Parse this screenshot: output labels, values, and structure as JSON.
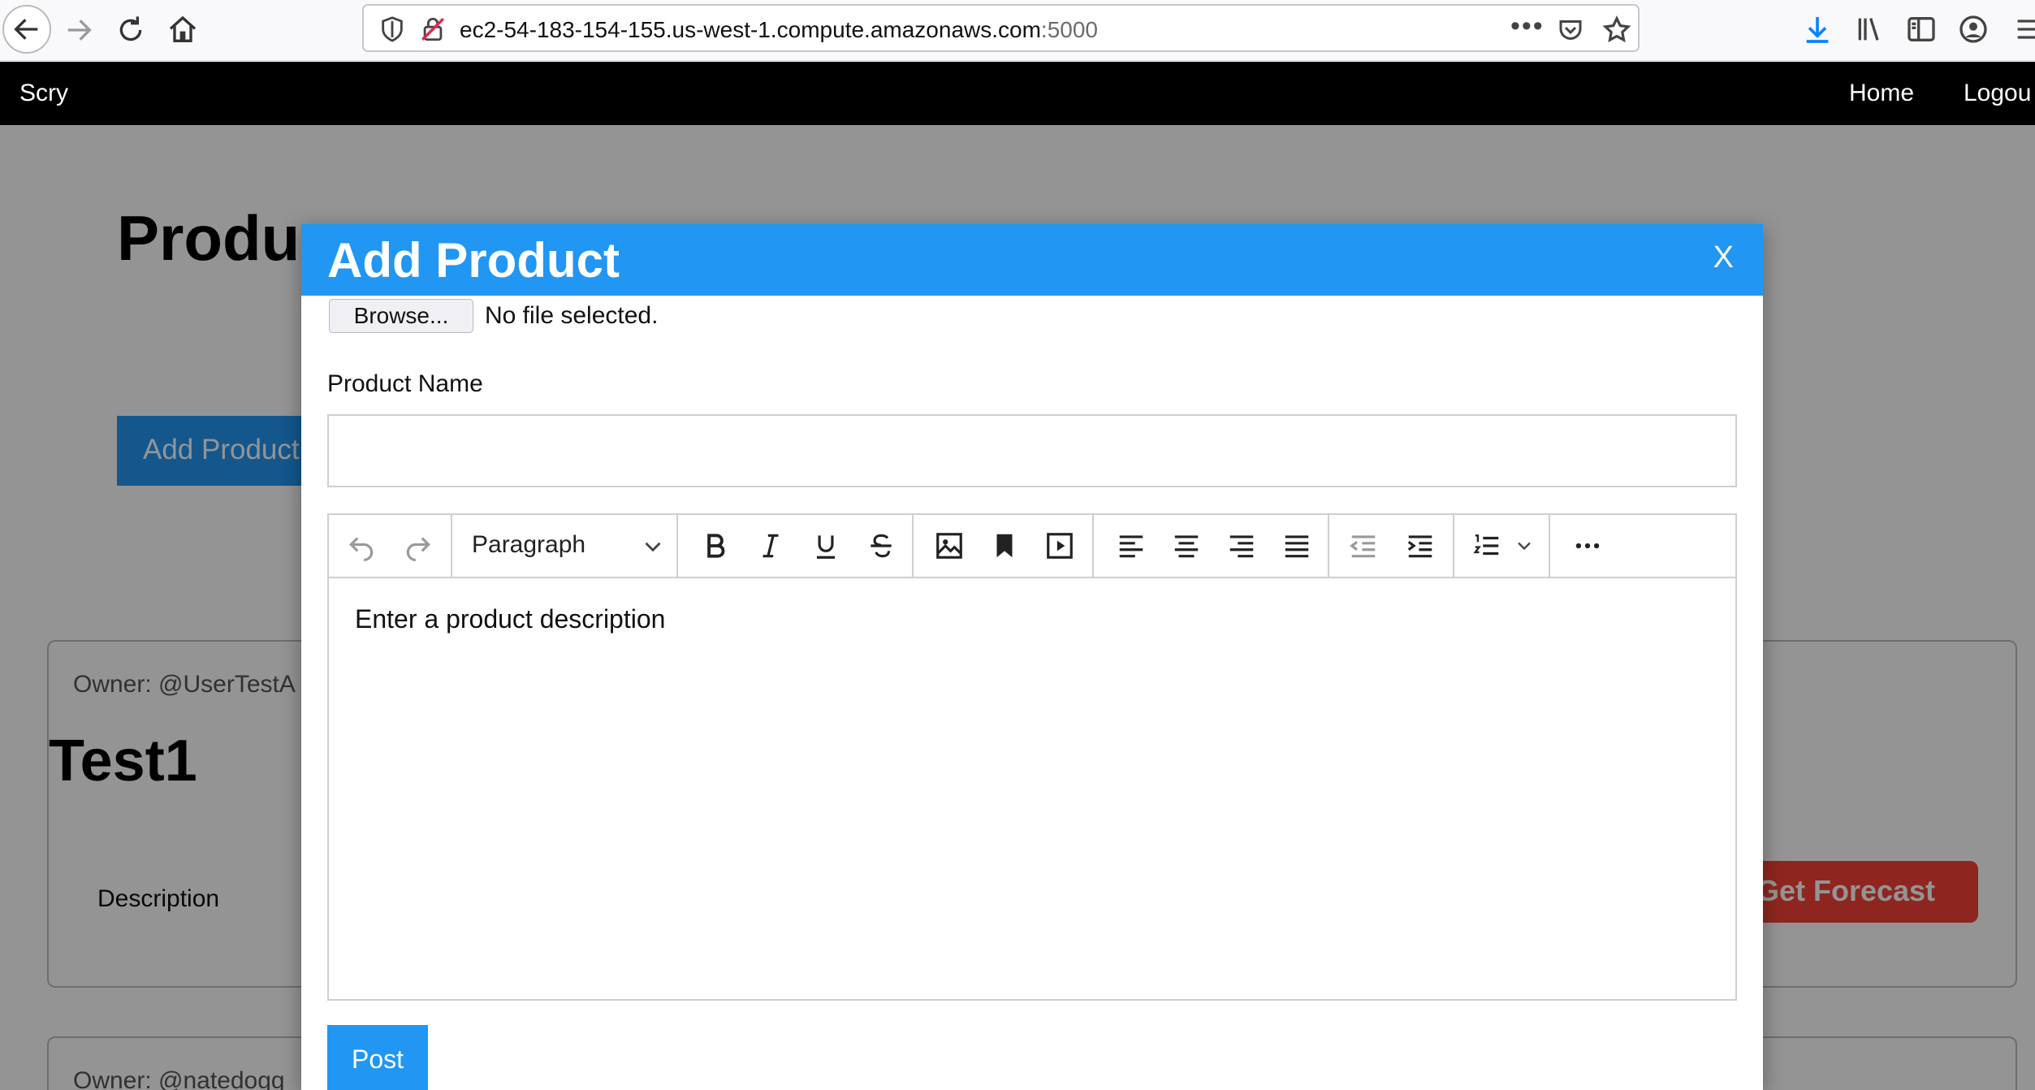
{
  "browser": {
    "url_host": "ec2-54-183-154-155.us-west-1.compute.amazonaws.com",
    "url_port": ":5000",
    "icons": [
      "back-icon",
      "forward-icon",
      "reload-icon",
      "home-icon",
      "shield-icon",
      "insecure-lock-icon",
      "more-dots-icon",
      "pocket-icon",
      "bookmark-star-icon",
      "download-icon",
      "library-icon",
      "sidebar-icon",
      "account-icon",
      "menu-icon"
    ]
  },
  "navbar": {
    "brand": "Scry",
    "home": "Home",
    "logout": "Logou"
  },
  "page": {
    "title": "Produc",
    "add_button": "Add Product"
  },
  "cards": [
    {
      "owner": "Owner: @UserTestA",
      "title": "Test1",
      "description_label": "Description",
      "forecast_button": "Get Forecast"
    },
    {
      "owner": "Owner: @natedogg"
    }
  ],
  "modal": {
    "title": "Add Product",
    "close": "X",
    "browse_button": "Browse...",
    "file_status": "No file selected.",
    "name_label": "Product Name",
    "name_value": "",
    "editor": {
      "format_select": "Paragraph",
      "placeholder": "Enter a product description",
      "toolbar_icons": [
        "undo-icon",
        "redo-icon",
        "bold-icon",
        "italic-icon",
        "underline-icon",
        "strikethrough-icon",
        "image-icon",
        "bookmark-icon",
        "media-icon",
        "align-left-icon",
        "align-center-icon",
        "align-right-icon",
        "justify-icon",
        "outdent-icon",
        "indent-icon",
        "numbered-list-icon",
        "more-icon"
      ]
    },
    "post_button": "Post"
  },
  "colors": {
    "primary": "#2196f3",
    "danger": "#f44336",
    "navbar": "#000000"
  }
}
